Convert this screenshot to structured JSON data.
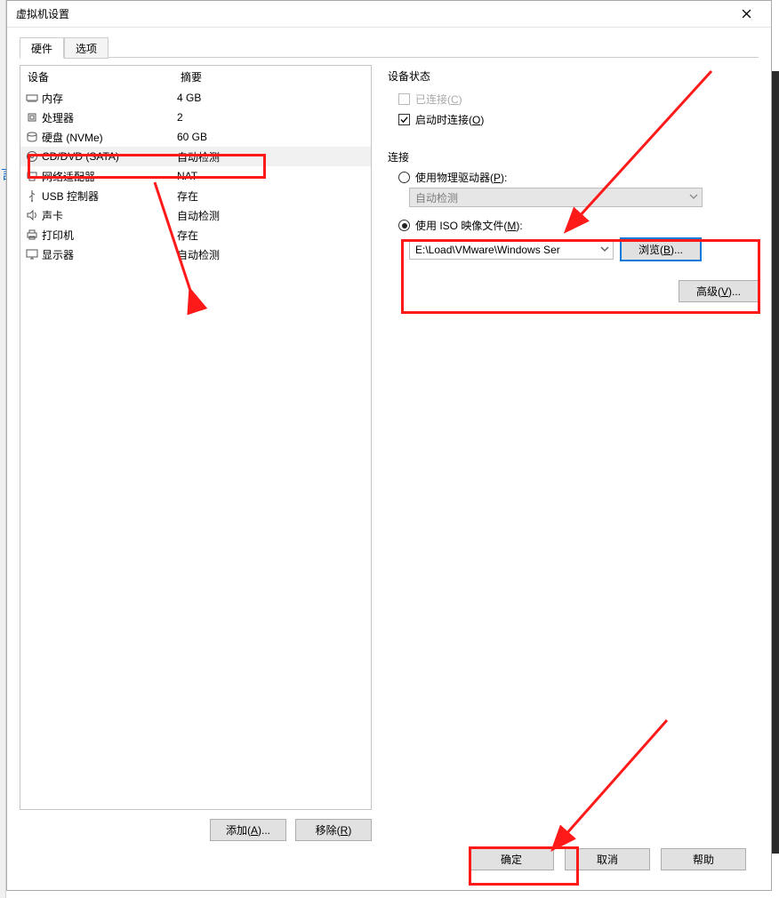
{
  "window": {
    "title": "虚拟机设置"
  },
  "tabs": {
    "hardware": "硬件",
    "options": "选项"
  },
  "device_list": {
    "header_device": "设备",
    "header_summary": "摘要",
    "rows": [
      {
        "name": "内存",
        "summary": "4 GB",
        "icon": "memory"
      },
      {
        "name": "处理器",
        "summary": "2",
        "icon": "cpu"
      },
      {
        "name": "硬盘 (NVMe)",
        "summary": "60 GB",
        "icon": "hdd"
      },
      {
        "name": "CD/DVD (SATA)",
        "summary": "自动检测",
        "icon": "cd",
        "selected": true
      },
      {
        "name": "网络适配器",
        "summary": "NAT",
        "icon": "net"
      },
      {
        "name": "USB 控制器",
        "summary": "存在",
        "icon": "usb"
      },
      {
        "name": "声卡",
        "summary": "自动检测",
        "icon": "sound"
      },
      {
        "name": "打印机",
        "summary": "存在",
        "icon": "printer"
      },
      {
        "name": "显示器",
        "summary": "自动检测",
        "icon": "display"
      }
    ]
  },
  "left_buttons": {
    "add": "添加(A)...",
    "remove": "移除(R)"
  },
  "right": {
    "device_status_title": "设备状态",
    "connected": "已连接(C)",
    "connect_at_poweron": "启动时连接(O)",
    "connection_title": "连接",
    "use_physical": "使用物理驱动器(P):",
    "phys_value": "自动检测",
    "use_iso": "使用 ISO 映像文件(M):",
    "iso_value": "E:\\Load\\VMware\\Windows Ser",
    "browse": "浏览(B)...",
    "advanced": "高级(V)..."
  },
  "footer": {
    "ok": "确定",
    "cancel": "取消",
    "help": "帮助"
  }
}
